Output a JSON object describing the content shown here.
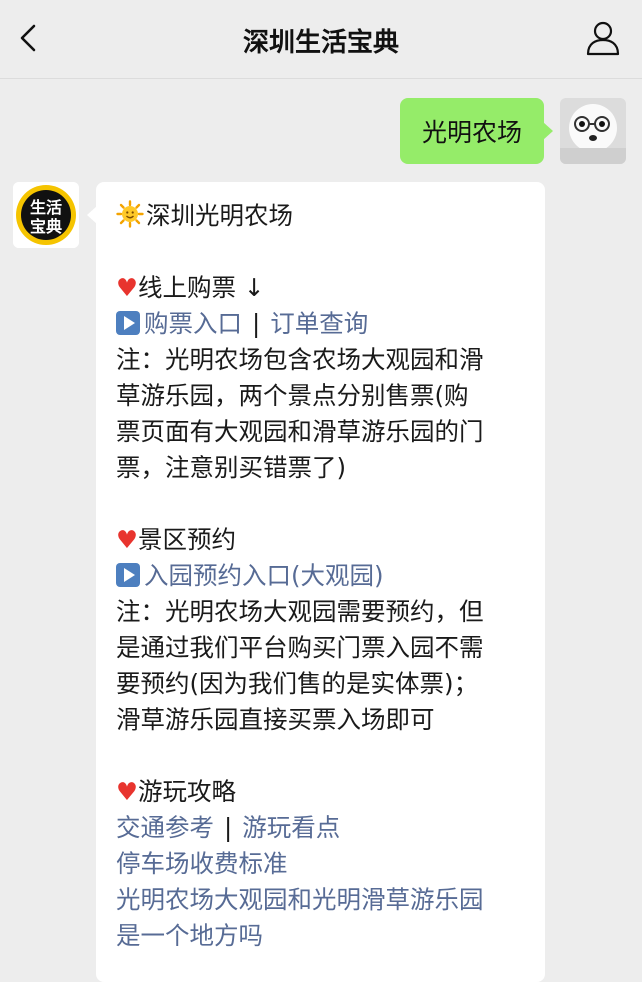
{
  "header": {
    "title": "深圳生活宝典",
    "back_icon": "chevron-left-icon",
    "profile_icon": "person-icon"
  },
  "chat": {
    "sent_message": "光明农场",
    "bot_avatar_text": "生活宝典",
    "reply": {
      "title": "深圳光明农场",
      "section1_heading": "线上购票 ↓",
      "section1_link1": "购票入口",
      "section1_link2": "订单查询",
      "section1_note_lines": [
        "注：光明农场包含农场大观园和滑",
        "草游乐园，两个景点分别售票(购",
        "票页面有大观园和滑草游乐园的门",
        "票，注意别买错票了)"
      ],
      "section2_heading": "景区预约",
      "section2_link": "入园预约入口(大观园)",
      "section2_note_lines": [
        "注：光明农场大观园需要预约，但",
        "是通过我们平台购买门票入园不需",
        "要预约(因为我们售的是实体票)；",
        "滑草游乐园直接买票入场即可"
      ],
      "section3_heading": "游玩攻略",
      "section3_link1": "交通参考",
      "section3_link2": "游玩看点",
      "section3_link3": "停车场收费标准",
      "section3_link4_lines": [
        "光明农场大观园和光明滑草游乐园",
        "是一个地方吗"
      ],
      "separator": "|"
    }
  },
  "colors": {
    "background": "#ededed",
    "sent_bubble": "#95ec69",
    "link": "#576b95",
    "heart": "#e8342e"
  }
}
